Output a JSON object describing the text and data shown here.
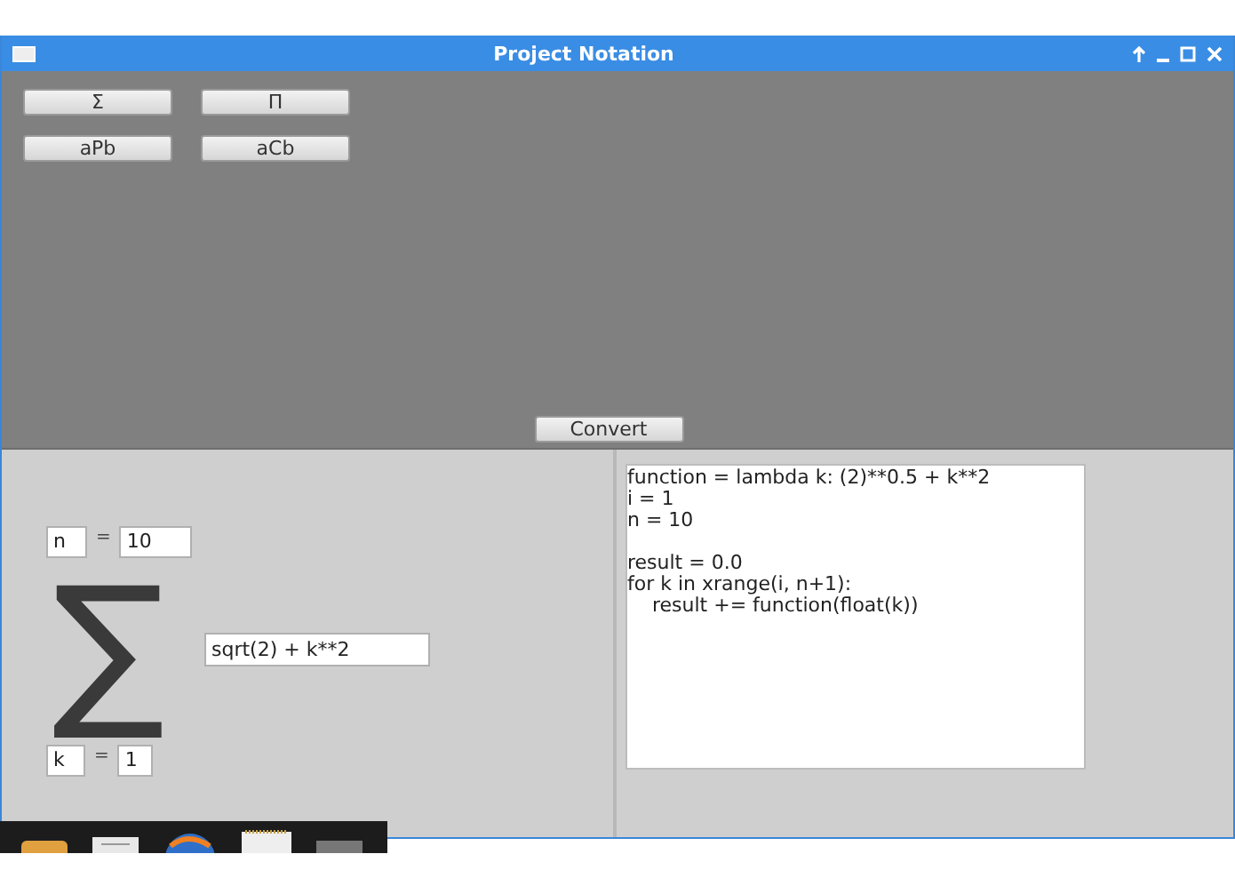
{
  "window": {
    "title": "Project Notation"
  },
  "notation_buttons": [
    {
      "label": "Σ"
    },
    {
      "label": "Π"
    },
    {
      "label": "aPb"
    },
    {
      "label": "aCb"
    }
  ],
  "convert_button": {
    "label": "Convert"
  },
  "editor": {
    "upper_variable": "n",
    "upper_equals": "=",
    "upper_value": "10",
    "symbol": "∑",
    "expression": "sqrt(2) + k**2",
    "lower_variable": "k",
    "lower_equals": "=",
    "lower_value": "1"
  },
  "code_output": "function = lambda k: (2)**0.5 + k**2\ni = 1\nn = 10\n\nresult = 0.0\nfor k in xrange(i, n+1):\n    result += function(float(k))"
}
